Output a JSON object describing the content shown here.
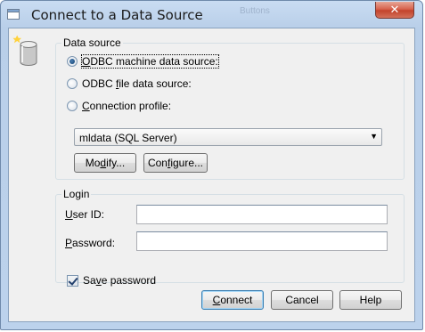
{
  "window": {
    "title": "Connect to a Data Source",
    "background_title_fragment": "Buttons",
    "close_glyph": "✕"
  },
  "datasource": {
    "legend": "Data source",
    "options": [
      {
        "mnemonic": "O",
        "rest": "DBC machine data source:",
        "checked": true
      },
      {
        "prefix": "ODBC ",
        "mnemonic": "f",
        "rest": "ile data source:",
        "checked": false
      },
      {
        "mnemonic": "C",
        "rest": "onnection profile:",
        "checked": false
      }
    ],
    "profile_selected": "mldata (SQL Server)",
    "modify_pre": "Mo",
    "modify_mn": "d",
    "modify_post": "ify...",
    "configure_pre": "Con",
    "configure_mn": "f",
    "configure_post": "igure..."
  },
  "login": {
    "legend": "Login",
    "user_mn": "U",
    "user_rest": "ser ID:",
    "user_value": "",
    "password_mn": "P",
    "password_rest": "assword:",
    "password_value": "",
    "save_pre": "Sa",
    "save_mn": "v",
    "save_post": "e password",
    "save_checked": true
  },
  "footer": {
    "connect_mn": "C",
    "connect_rest": "onnect",
    "cancel_label": "Cancel",
    "help_label": "Help"
  },
  "icons": {
    "title_icon": "window-app-icon",
    "datasource_icon": "database-cylinder-icon",
    "dropdown_icon": "chevron-down-icon"
  },
  "colors": {
    "titlebar": "#c9dcf2",
    "client": "#f0f0f0",
    "close_button": "#c3432c",
    "default_button_border": "#3c7fb1"
  }
}
